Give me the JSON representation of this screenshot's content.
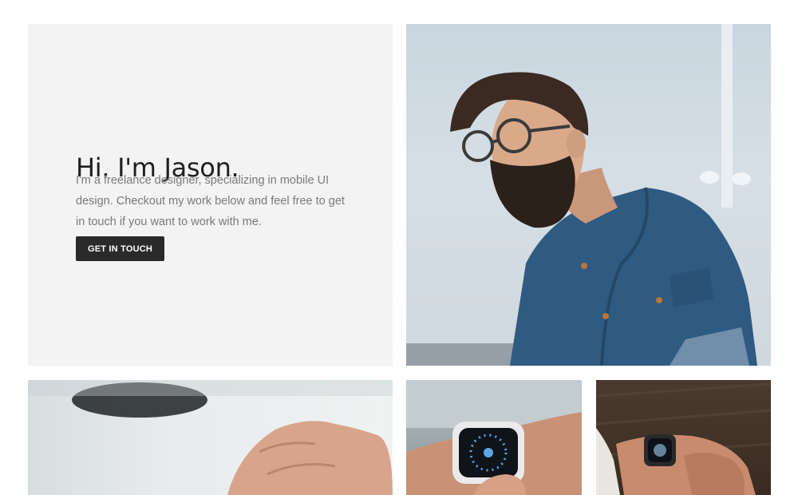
{
  "hero": {
    "title": "Hi. I'm Jason.",
    "description": "I'm a freelance designer, specializing in mobile UI design. Checkout my work below and feel free to get in touch if you want to work with me.",
    "cta_label": "GET IN TOUCH"
  },
  "colors": {
    "panel_bg": "#f3f3f3",
    "button_bg": "#2a2a2a",
    "title_text": "#1f1f1f",
    "body_text": "#7a7a7a",
    "denim": "#2f5a82"
  },
  "images": {
    "portrait": "portrait-photo",
    "laptop": "hands-typing-photo",
    "watch": "smartwatch-photo",
    "wood": "watch-on-wood-photo"
  }
}
